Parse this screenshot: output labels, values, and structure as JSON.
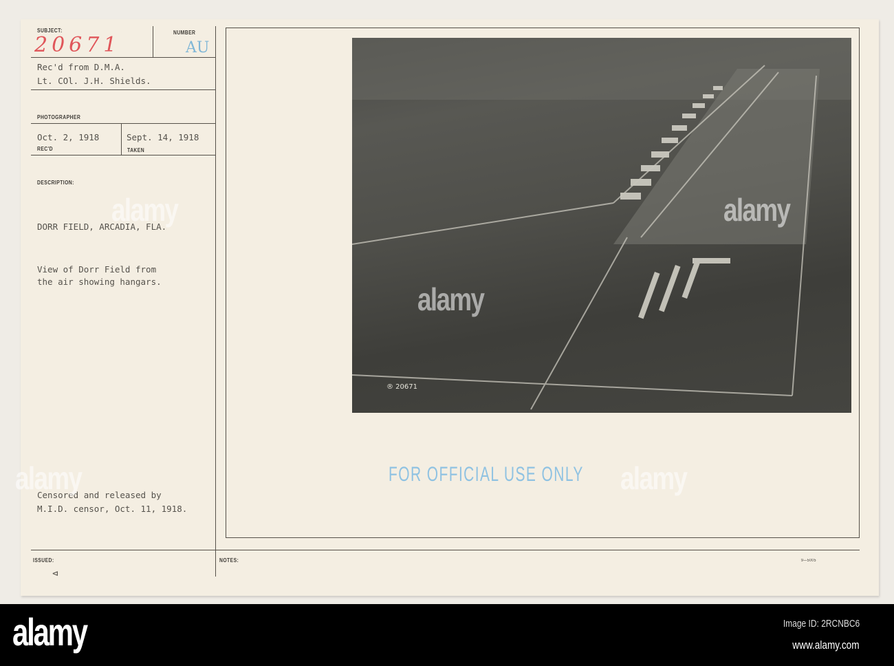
{
  "card": {
    "subject_label": "SUBJECT:",
    "subject_number": "20671",
    "number_label": "NUMBER",
    "number_value": "AU",
    "received_from_line1": "Rec'd from D.M.A.",
    "received_from_line2": "Lt. COl. J.H. Shields.",
    "photographer_label": "PHOTOGRAPHER",
    "date_received": "Oct. 2, 1918",
    "date_received_label": "REC'D",
    "date_taken": "Sept. 14, 1918",
    "date_taken_label": "TAKEN",
    "description_label": "DESCRIPTION:",
    "location": "DORR FIELD, ARCADIA, FLA.",
    "description_line1": "View of Dorr Field from",
    "description_line2": "the air showing hangars.",
    "censor_line1": "Censored and released by",
    "censor_line2": "M.I.D. censor, Oct. 11, 1918.",
    "issued_label": "ISSUED:",
    "issued_mark": "⊲",
    "notes_label": "NOTES:",
    "form_number": "9—5005",
    "photo_caption": "® 20671",
    "stamp": "FOR OFFICIAL USE ONLY"
  },
  "watermark": "alamy",
  "footer": {
    "logo": "alamy",
    "image_id": "Image ID: 2RCNBC6",
    "url": "www.alamy.com"
  }
}
